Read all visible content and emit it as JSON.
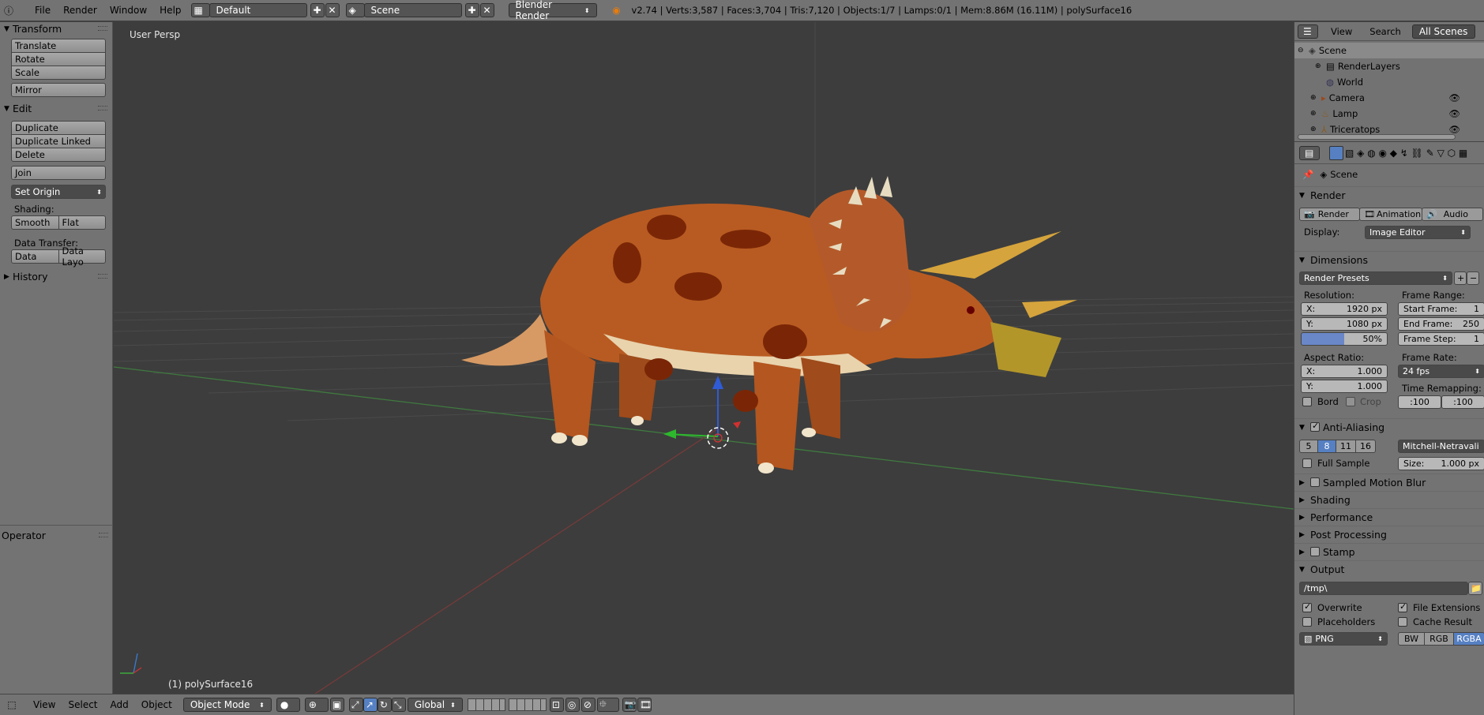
{
  "topbar": {
    "menus": [
      "File",
      "Render",
      "Window",
      "Help"
    ],
    "layout": "Default",
    "scene": "Scene",
    "engine": "Blender Render",
    "info": "v2.74 | Verts:3,587 | Faces:3,704 | Tris:7,120 | Objects:1/7 | Lamps:0/1 | Mem:8.86M (16.11M) | polySurface16"
  },
  "left": {
    "transform_title": "Transform",
    "translate": "Translate",
    "rotate": "Rotate",
    "scale": "Scale",
    "mirror": "Mirror",
    "edit_title": "Edit",
    "duplicate": "Duplicate",
    "duplicate_linked": "Duplicate Linked",
    "delete": "Delete",
    "join": "Join",
    "set_origin": "Set Origin",
    "shading_label": "Shading:",
    "smooth": "Smooth",
    "flat": "Flat",
    "data_transfer_label": "Data Transfer:",
    "data": "Data",
    "data_layo": "Data Layo",
    "history_title": "History",
    "operator_title": "Operator"
  },
  "viewport": {
    "view_name": "User Persp",
    "object_label": "(1) polySurface16"
  },
  "bottombar": {
    "view": "View",
    "select": "Select",
    "add": "Add",
    "object": "Object",
    "mode": "Object Mode",
    "orientation": "Global"
  },
  "outliner": {
    "view": "View",
    "search": "Search",
    "all_scenes": "All Scenes",
    "items": [
      "Scene",
      "RenderLayers",
      "World",
      "Camera",
      "Lamp",
      "Triceratops"
    ]
  },
  "properties": {
    "context": "Scene",
    "render_title": "Render",
    "render_btn": "Render",
    "animation_btn": "Animation",
    "audio_btn": "Audio",
    "display_label": "Display:",
    "display_value": "Image Editor",
    "dimensions_title": "Dimensions",
    "render_presets": "Render Presets",
    "resolution_label": "Resolution:",
    "res_x_label": "X:",
    "res_x": "1920 px",
    "res_y_label": "Y:",
    "res_y": "1080 px",
    "res_pct": "50%",
    "frame_range_label": "Frame Range:",
    "start_frame_label": "Start Frame:",
    "start_frame": "1",
    "end_frame_label": "End Frame:",
    "end_frame": "250",
    "frame_step_label": "Frame Step:",
    "frame_step": "1",
    "aspect_label": "Aspect Ratio:",
    "aspect_x_label": "X:",
    "aspect_x": "1.000",
    "aspect_y_label": "Y:",
    "aspect_y": "1.000",
    "frame_rate_label": "Frame Rate:",
    "frame_rate": "24 fps",
    "time_remap_label": "Time Remapping:",
    "remap_old": ":100",
    "remap_new": ":100",
    "bord": "Bord",
    "crop": "Crop",
    "aa_title": "Anti-Aliasing",
    "aa_samples": [
      "5",
      "8",
      "11",
      "16"
    ],
    "aa_filter": "Mitchell-Netravali",
    "full_sample": "Full Sample",
    "size_label": "Size:",
    "size_value": "1.000 px",
    "motion_blur": "Sampled Motion Blur",
    "shading": "Shading",
    "performance": "Performance",
    "post_processing": "Post Processing",
    "stamp": "Stamp",
    "output_title": "Output",
    "output_path": "/tmp\\",
    "overwrite": "Overwrite",
    "file_extensions": "File Extensions",
    "placeholders": "Placeholders",
    "cache_result": "Cache Result",
    "format": "PNG",
    "bw": "BW",
    "rgb": "RGB",
    "rgba": "RGBA"
  }
}
